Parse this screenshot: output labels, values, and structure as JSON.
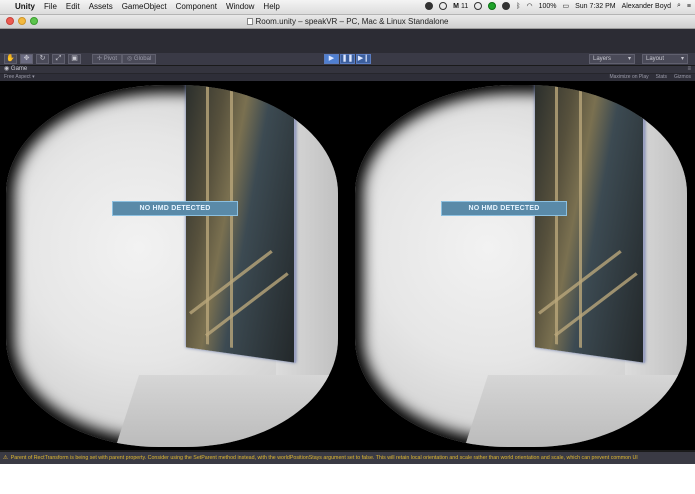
{
  "menubar": {
    "app_name": "Unity",
    "items": [
      "File",
      "Edit",
      "Assets",
      "GameObject",
      "Component",
      "Window",
      "Help"
    ],
    "status_count": "11",
    "battery": "100%",
    "clock": "Sun 7:32 PM",
    "user": "Alexander Boyd"
  },
  "window": {
    "title": "Room.unity – speakVR – PC, Mac & Linux Standalone"
  },
  "toolbar": {
    "pivot_label": "Pivot",
    "global_label": "Global",
    "layers_label": "Layers",
    "layout_label": "Layout"
  },
  "game_view": {
    "tab_label": "Game",
    "aspect_label": "Free Aspect",
    "maximize_label": "Maximize on Play",
    "stats_label": "Stats",
    "gizmos_label": "Gizmos",
    "hmd_left": "NO HMD DETECTED",
    "hmd_right": "NO HMD DETECTED"
  },
  "console": {
    "message": "Parent of RectTransform is being set with parent property. Consider using the SetParent method instead, with the worldPositionStays argument set to false. This will retain local orientation and scale rather than world orientation and scale, which can prevent common UI"
  },
  "colors": {
    "warning": "#e0b830",
    "play_active": "#4f7fd0",
    "hmd_label_bg": "#5a8aa8"
  }
}
